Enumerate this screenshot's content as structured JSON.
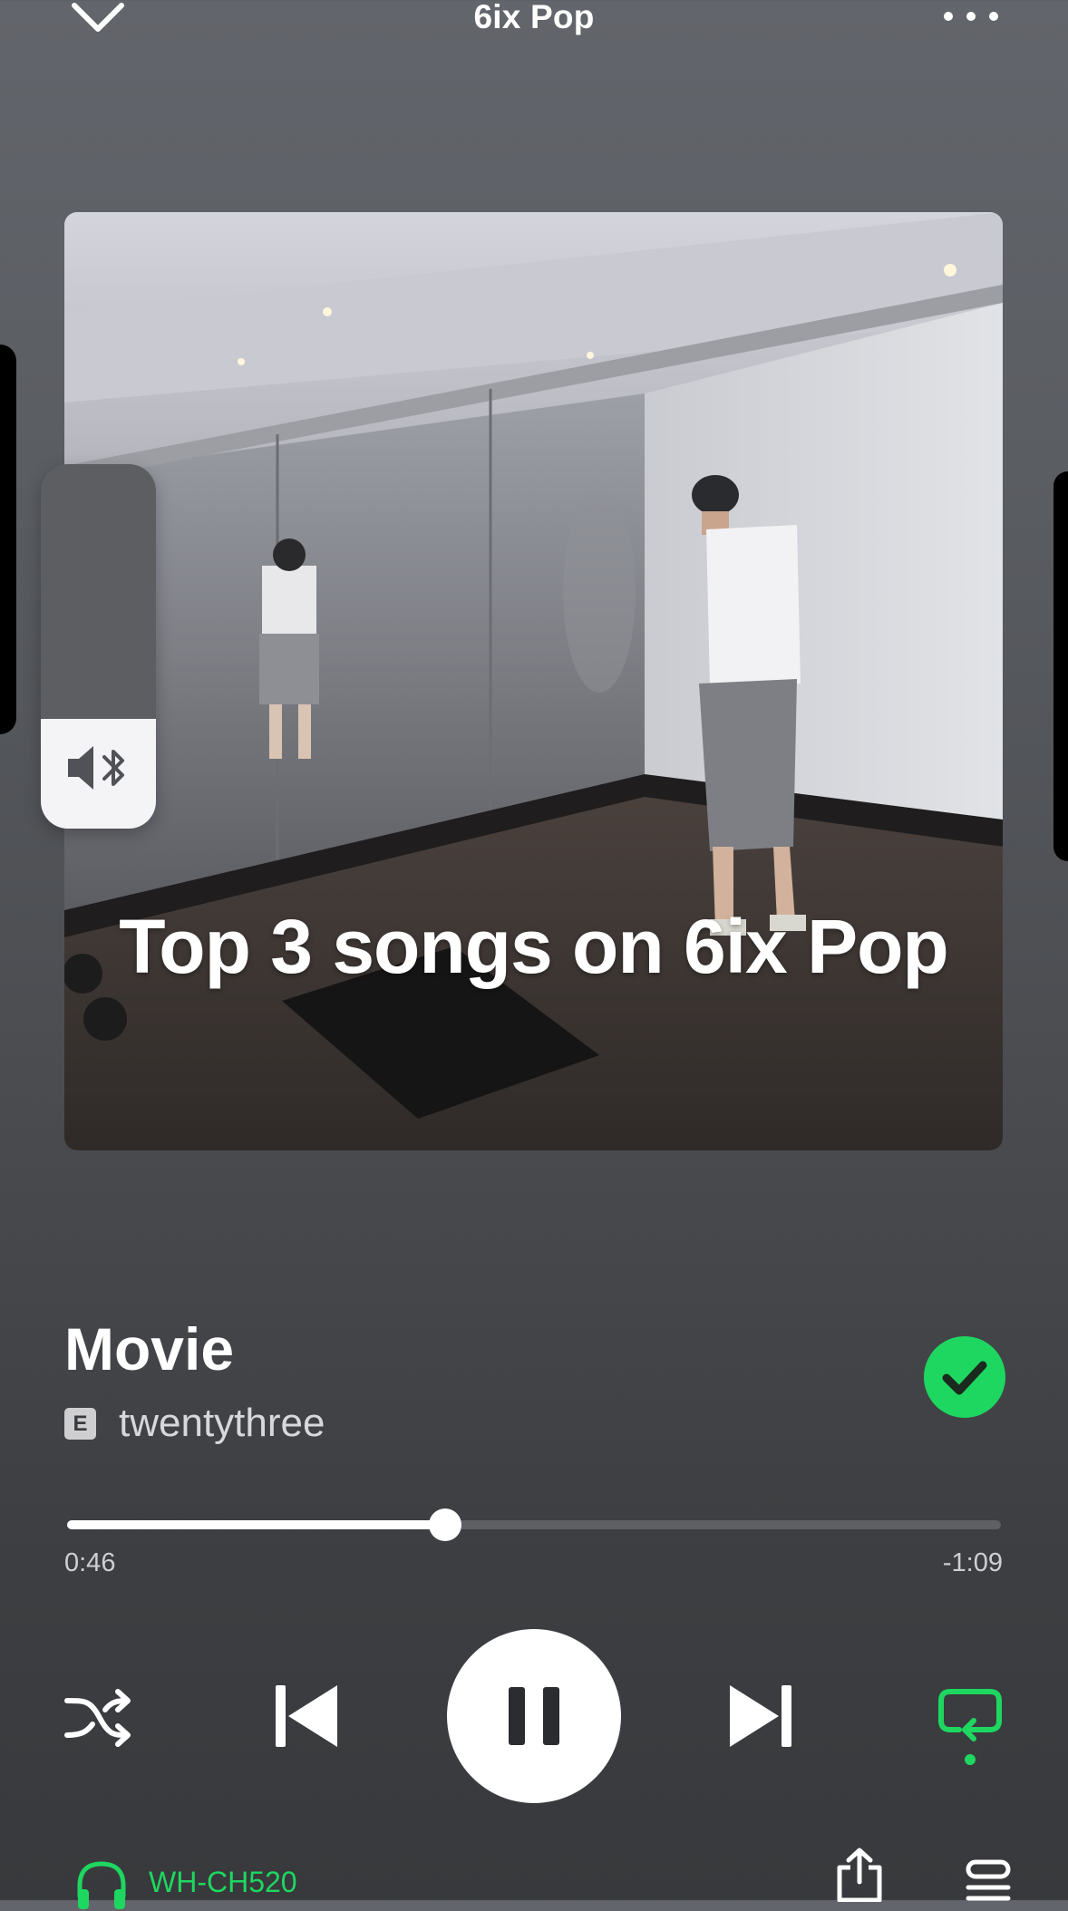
{
  "header": {
    "title": "6ix Pop",
    "collapse_icon": "chevron-down-icon",
    "more_icon": "more-horizontal-icon"
  },
  "artwork": {
    "caption": "Top 3 songs on 6ix Pop"
  },
  "volume_hud": {
    "level": 0.3,
    "icon": "speaker-bluetooth-icon"
  },
  "track": {
    "title": "Movie",
    "explicit_badge": "E",
    "artist": "twentythree",
    "liked": true,
    "liked_icon": "check-icon"
  },
  "progress": {
    "fraction": 0.405,
    "elapsed": "0:46",
    "remaining": "-1:09"
  },
  "controls": {
    "shuffle_icon": "shuffle-icon",
    "previous_icon": "skip-previous-icon",
    "play_state": "playing",
    "pause_icon": "pause-icon",
    "next_icon": "skip-next-icon",
    "repeat_icon": "repeat-icon",
    "repeat_active": true
  },
  "bottom": {
    "device_name": "WH-CH520",
    "device_icon": "headphones-icon",
    "share_icon": "share-icon",
    "queue_icon": "queue-icon"
  },
  "colors": {
    "accent": "#1ed760",
    "background_top": "#62656b",
    "background_bottom": "#38393c"
  }
}
